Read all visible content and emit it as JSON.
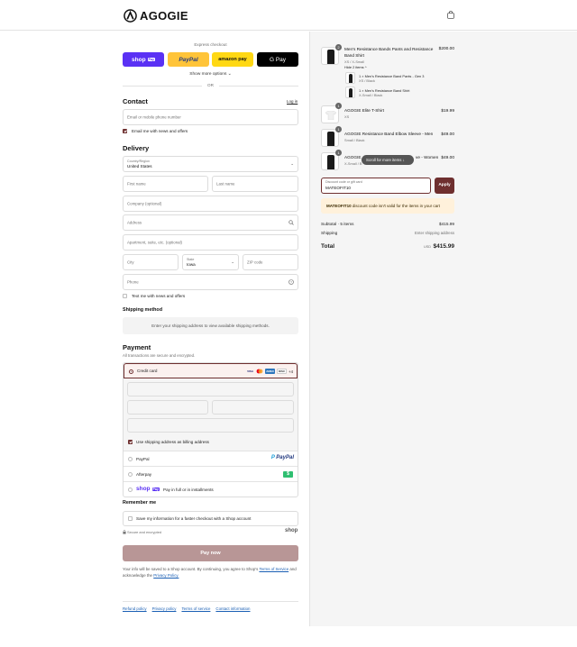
{
  "brand": {
    "name": "AGOGIE"
  },
  "express": {
    "title": "Express checkout",
    "shop_label": "shop",
    "shop_badge": "Pay",
    "paypal_label": "PayPal",
    "amazon_label": "amazon pay",
    "gpay_label": "G Pay",
    "more_options": "Show more options ⌄",
    "or": "OR"
  },
  "contact": {
    "title": "Contact",
    "login": "Log in",
    "email_placeholder": "Email or mobile phone number",
    "news_label": "Email me with news and offers"
  },
  "delivery": {
    "title": "Delivery",
    "country_label": "Country/Region",
    "country_value": "United States",
    "first_name": "First name",
    "last_name": "Last name",
    "company": "Company (optional)",
    "address": "Address",
    "apartment": "Apartment, suite, etc. (optional)",
    "city": "City",
    "state_label": "State",
    "state_value": "Iowa",
    "zip": "ZIP code",
    "phone": "Phone",
    "text_label": "Text me with news and offers"
  },
  "shipping": {
    "title": "Shipping method",
    "message": "Enter your shipping address to view available shipping methods."
  },
  "payment": {
    "title": "Payment",
    "subtitle": "All transactions are secure and encrypted.",
    "credit_card": "Credit card",
    "card_more": "+4",
    "billing_same": "Use shipping address as billing address",
    "paypal": "PayPal",
    "afterpay": "Afterpay",
    "shoppay_text": "Pay in full or in installments",
    "shoppay_logo": "shop",
    "shoppay_badge": "Pay"
  },
  "remember": {
    "title": "Remember me",
    "save_label": "Save my information for a faster checkout with a Shop account",
    "secure": "Secure and encrypted",
    "shop_logo": "shop"
  },
  "pay_now": "Pay now",
  "legal": {
    "text": "Your info will be saved to a Shop account. By continuing, you agree to Shop's",
    "terms": "Terms of Service",
    "and": "and acknowledge the",
    "privacy": "Privacy Policy."
  },
  "footer": [
    "Refund policy",
    "Privacy policy",
    "Terms of service",
    "Contact information"
  ],
  "order": {
    "items": [
      {
        "qty": "2",
        "name_line1": "Men's Resistance Bands Pants and Resistance",
        "name_line2": "Band Shirt",
        "variant": "XS / X-Small",
        "price": "$200.00"
      },
      {
        "qty": "1",
        "name": "AGOGIE Elite T-Shirt",
        "variant": "XS",
        "price": "$19.99"
      },
      {
        "qty": "1",
        "name": "AGOGIE Resistance Band Elbow Sleeve - Men",
        "variant": "Small / Black",
        "price": "$49.00"
      },
      {
        "qty": "1",
        "name": "AGOGIE",
        "name_tail": "ve - Women",
        "variant": "X-Small / B",
        "price": "$49.00"
      }
    ],
    "hide_items": "Hide 2 items ^",
    "sub_items": [
      {
        "name": "1 × Men's Resistance Band Pants - Gen 3",
        "variant": "XS / Black"
      },
      {
        "name": "1 × Men's Resistance Band Shirt",
        "variant": "X-Small / Black"
      }
    ],
    "scroll_tip": "Scroll for more items ↓",
    "discount_label": "Discount code or gift card",
    "discount_value": "MATEOFIT10",
    "apply": "Apply",
    "warning_code": "MATEOFIT10",
    "warning_text": " discount code isn't valid for the items in your cart",
    "subtotal_label": "Subtotal · 5 items",
    "subtotal_value": "$415.99",
    "shipping_label": "Shipping",
    "shipping_value": "Enter shipping address",
    "total_label": "Total",
    "currency": "USD",
    "total_value": "$415.99"
  }
}
